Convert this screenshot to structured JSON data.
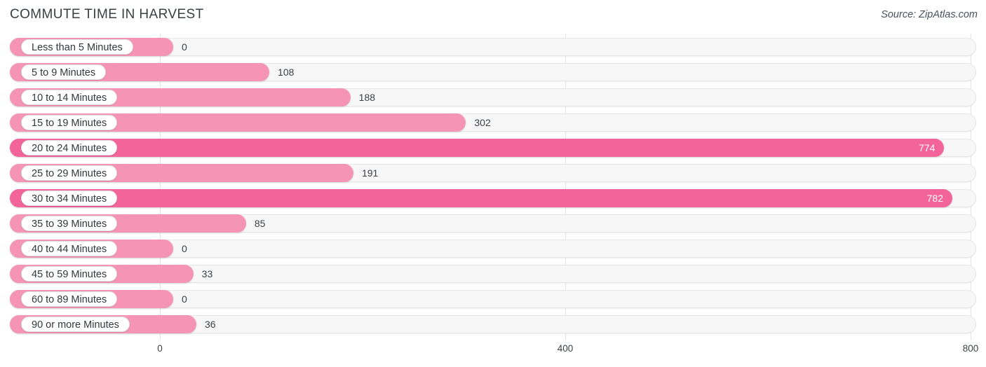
{
  "header": {
    "title": "COMMUTE TIME IN HARVEST",
    "source": "Source: ZipAtlas.com"
  },
  "axis": {
    "ticks": [
      "0",
      "400",
      "800"
    ]
  },
  "colors": {
    "bar_light": "#F594B4",
    "bar_dark": "#F2649A",
    "track": "#F7F7F7",
    "grid": "#E3E3E3",
    "text": "#3B4045",
    "value_inside": "#FFFFFF"
  },
  "chart_data": {
    "type": "bar",
    "orientation": "horizontal",
    "title": "COMMUTE TIME IN HARVEST",
    "subtitle": "Source: ZipAtlas.com",
    "xlabel": "",
    "ylabel": "",
    "xlim": [
      0,
      800
    ],
    "xticks": [
      0,
      400,
      800
    ],
    "grid": true,
    "legend": null,
    "categories": [
      "Less than 5 Minutes",
      "5 to 9 Minutes",
      "10 to 14 Minutes",
      "15 to 19 Minutes",
      "20 to 24 Minutes",
      "25 to 29 Minutes",
      "30 to 34 Minutes",
      "35 to 39 Minutes",
      "40 to 44 Minutes",
      "45 to 59 Minutes",
      "60 to 89 Minutes",
      "90 or more Minutes"
    ],
    "values": [
      0,
      108,
      188,
      302,
      774,
      191,
      782,
      85,
      0,
      33,
      0,
      36
    ],
    "value_labels": [
      "0",
      "108",
      "188",
      "302",
      "774",
      "191",
      "782",
      "85",
      "0",
      "33",
      "0",
      "36"
    ],
    "highlight": [
      false,
      false,
      false,
      false,
      true,
      false,
      true,
      false,
      false,
      false,
      false,
      false
    ]
  }
}
